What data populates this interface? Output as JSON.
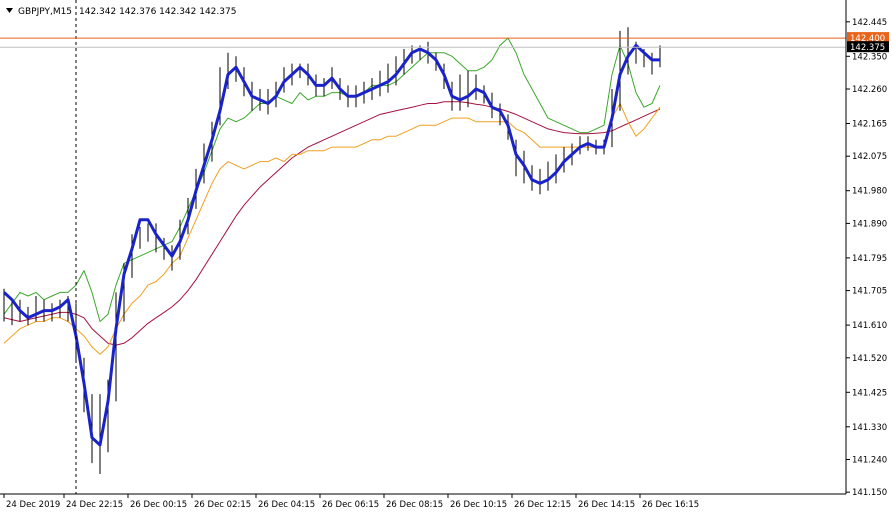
{
  "header": {
    "menu_icon": "triangle-down-icon",
    "symbol": "GBPJPY,M15",
    "ohlc": "142.342 142.376 142.342 142.375"
  },
  "chart_data": {
    "type": "line",
    "title": "GBPJPY,M15",
    "xlabel": "",
    "ylabel": "",
    "ylim": [
      141.145,
      142.505
    ],
    "grid": false,
    "legend": "none",
    "y_ticks": [
      "142.445",
      "142.350",
      "142.260",
      "142.165",
      "142.075",
      "141.980",
      "141.890",
      "141.795",
      "141.705",
      "141.610",
      "141.520",
      "141.425",
      "141.330",
      "141.240",
      "141.150"
    ],
    "x_ticks": [
      "24 Dec 2019",
      "24 Dec 22:15",
      "26 Dec 00:15",
      "26 Dec 02:15",
      "26 Dec 04:15",
      "26 Dec 06:15",
      "26 Dec 08:15",
      "26 Dec 10:15",
      "26 Dec 12:15",
      "26 Dec 14:15",
      "26 Dec 16:15"
    ],
    "x_tick_positions": [
      0,
      15,
      31,
      47,
      63,
      79,
      95,
      111,
      127,
      143,
      159
    ],
    "x": [
      0,
      2,
      4,
      6,
      8,
      10,
      12,
      14,
      16,
      18,
      20,
      22,
      24,
      26,
      28,
      30,
      32,
      34,
      36,
      38,
      40,
      42,
      44,
      46,
      48,
      50,
      52,
      54,
      56,
      58,
      60,
      62,
      64,
      66,
      68,
      70,
      72,
      74,
      76,
      78,
      80,
      82,
      84,
      86,
      88,
      90,
      92,
      94,
      96,
      98,
      100,
      102,
      104,
      106,
      108,
      110,
      112,
      114,
      116,
      118,
      120,
      122,
      124,
      126,
      128,
      130,
      132,
      134,
      136,
      138,
      140,
      142,
      144,
      146,
      148,
      150,
      152,
      154,
      156,
      158,
      160,
      162,
      164
    ],
    "series": [
      {
        "role": "fast",
        "color": "#1a23c9",
        "values": [
          141.7,
          141.68,
          141.65,
          141.63,
          141.64,
          141.65,
          141.65,
          141.66,
          141.68,
          141.58,
          141.45,
          141.3,
          141.28,
          141.4,
          141.6,
          141.75,
          141.82,
          141.9,
          141.9,
          141.86,
          141.83,
          141.8,
          141.84,
          141.9,
          141.98,
          142.05,
          142.12,
          142.2,
          142.3,
          142.32,
          142.28,
          142.24,
          142.23,
          142.22,
          142.24,
          142.28,
          142.3,
          142.32,
          142.3,
          142.27,
          142.27,
          142.29,
          142.26,
          142.24,
          142.24,
          142.25,
          142.26,
          142.27,
          142.28,
          142.3,
          142.33,
          142.36,
          142.37,
          142.36,
          142.34,
          142.3,
          142.24,
          142.23,
          142.24,
          142.26,
          142.25,
          142.21,
          142.2,
          142.16,
          142.08,
          142.05,
          142.01,
          142.0,
          142.01,
          142.03,
          142.06,
          142.08,
          142.1,
          142.11,
          142.1,
          142.1,
          142.18,
          142.3,
          142.35,
          142.38,
          142.36,
          142.34,
          142.34
        ]
      },
      {
        "role": "slow",
        "color": "#a5123f",
        "values": [
          141.63,
          141.625,
          141.62,
          141.625,
          141.63,
          141.635,
          141.64,
          141.645,
          141.645,
          141.64,
          141.63,
          141.6,
          141.58,
          141.56,
          141.555,
          141.56,
          141.575,
          141.595,
          141.615,
          141.63,
          141.645,
          141.66,
          141.68,
          141.705,
          141.735,
          141.77,
          141.805,
          141.84,
          141.875,
          141.91,
          141.94,
          141.965,
          141.99,
          142.01,
          142.03,
          142.05,
          142.07,
          142.085,
          142.1,
          142.11,
          142.12,
          142.13,
          142.14,
          142.15,
          142.16,
          142.17,
          142.18,
          142.19,
          142.195,
          142.2,
          142.205,
          142.21,
          142.215,
          142.22,
          142.22,
          142.225,
          142.225,
          142.225,
          142.222,
          142.218,
          142.215,
          142.21,
          142.205,
          142.198,
          142.19,
          142.18,
          142.17,
          142.16,
          142.15,
          142.145,
          142.14,
          142.138,
          142.137,
          142.137,
          142.138,
          142.14,
          142.145,
          142.155,
          142.165,
          142.175,
          142.185,
          142.195,
          142.205
        ]
      },
      {
        "role": "upper",
        "color": "#3aa82a",
        "values": [
          141.64,
          141.67,
          141.7,
          141.69,
          141.7,
          141.68,
          141.69,
          141.7,
          141.7,
          141.72,
          141.76,
          141.7,
          141.62,
          141.64,
          141.72,
          141.78,
          141.79,
          141.8,
          141.81,
          141.82,
          141.83,
          141.84,
          141.88,
          141.93,
          141.98,
          142.03,
          142.09,
          142.15,
          142.18,
          142.17,
          142.18,
          142.2,
          142.22,
          142.22,
          142.24,
          142.23,
          142.22,
          142.25,
          142.23,
          142.24,
          142.24,
          142.25,
          142.25,
          142.24,
          142.24,
          142.25,
          142.27,
          142.27,
          142.27,
          142.28,
          142.3,
          142.32,
          142.34,
          142.36,
          142.36,
          142.36,
          142.35,
          142.33,
          142.31,
          142.31,
          142.32,
          142.34,
          142.38,
          142.4,
          142.36,
          142.3,
          142.26,
          142.22,
          142.18,
          142.17,
          142.16,
          142.15,
          142.14,
          142.14,
          142.15,
          142.16,
          142.3,
          142.38,
          142.33,
          142.25,
          142.21,
          142.22,
          142.27
        ]
      },
      {
        "role": "lower",
        "color": "#f0a020",
        "values": [
          141.56,
          141.58,
          141.6,
          141.61,
          141.62,
          141.62,
          141.63,
          141.63,
          141.62,
          141.6,
          141.58,
          141.55,
          141.53,
          141.55,
          141.6,
          141.64,
          141.67,
          141.69,
          141.72,
          141.73,
          141.75,
          141.78,
          141.8,
          141.85,
          141.9,
          141.95,
          142.0,
          142.04,
          142.06,
          142.05,
          142.04,
          142.05,
          142.06,
          142.06,
          142.07,
          142.06,
          142.08,
          142.08,
          142.09,
          142.09,
          142.09,
          142.1,
          142.1,
          142.1,
          142.1,
          142.11,
          142.12,
          142.12,
          142.13,
          142.13,
          142.14,
          142.15,
          142.16,
          142.16,
          142.16,
          142.17,
          142.18,
          142.18,
          142.18,
          142.17,
          142.17,
          142.17,
          142.17,
          142.17,
          142.15,
          142.14,
          142.12,
          142.1,
          142.1,
          142.1,
          142.1,
          142.1,
          142.1,
          142.1,
          142.1,
          142.1,
          142.18,
          142.22,
          142.17,
          142.13,
          142.15,
          142.18,
          142.21
        ]
      }
    ],
    "candles": {
      "high": [
        141.71,
        141.68,
        141.68,
        141.66,
        141.69,
        141.68,
        141.67,
        141.68,
        141.69,
        141.67,
        141.52,
        141.42,
        141.42,
        141.46,
        141.7,
        141.78,
        141.86,
        141.88,
        141.89,
        141.89,
        141.85,
        141.83,
        141.9,
        141.96,
        142.04,
        142.11,
        142.17,
        142.32,
        142.36,
        142.35,
        142.32,
        142.28,
        142.26,
        142.26,
        142.28,
        142.32,
        142.33,
        142.33,
        142.33,
        142.3,
        142.29,
        142.32,
        142.29,
        142.27,
        142.27,
        142.28,
        142.29,
        142.31,
        142.33,
        142.35,
        142.37,
        142.38,
        142.38,
        142.39,
        142.36,
        142.33,
        142.28,
        142.3,
        142.31,
        142.3,
        142.27,
        142.25,
        142.22,
        142.19,
        142.12,
        142.09,
        142.05,
        142.04,
        142.06,
        142.08,
        142.1,
        142.11,
        142.13,
        142.13,
        142.12,
        142.12,
        142.26,
        142.42,
        142.43,
        142.39,
        142.37,
        142.36,
        142.38
      ],
      "low": [
        141.62,
        141.61,
        141.62,
        141.61,
        141.62,
        141.62,
        141.62,
        141.63,
        141.62,
        141.51,
        141.37,
        141.23,
        141.2,
        141.26,
        141.4,
        141.62,
        141.74,
        141.82,
        141.84,
        141.81,
        141.79,
        141.76,
        141.79,
        141.86,
        141.93,
        142.0,
        142.06,
        142.16,
        142.26,
        142.28,
        142.24,
        142.2,
        142.2,
        142.19,
        142.21,
        142.25,
        142.27,
        142.29,
        142.27,
        142.24,
        142.24,
        142.26,
        142.23,
        142.21,
        142.21,
        142.22,
        142.23,
        142.24,
        142.25,
        142.27,
        142.3,
        142.33,
        142.34,
        142.33,
        142.31,
        142.26,
        142.2,
        142.2,
        142.21,
        142.23,
        142.22,
        142.18,
        142.16,
        142.12,
        142.02,
        142.0,
        141.98,
        141.97,
        141.98,
        142.0,
        142.03,
        142.05,
        142.08,
        142.09,
        142.08,
        142.08,
        142.1,
        142.2,
        142.3,
        142.33,
        142.32,
        142.3,
        142.32
      ]
    },
    "last_price": "142.375",
    "level_line": "142.400",
    "cursor_x": 18
  }
}
